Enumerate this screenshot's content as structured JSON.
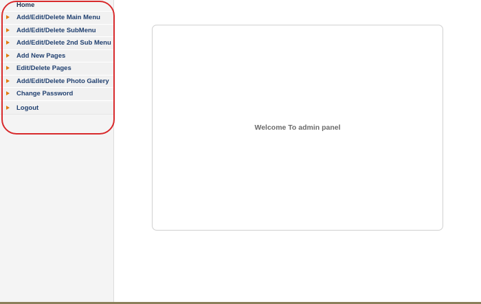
{
  "sidebar": {
    "items": [
      {
        "label": "Home"
      },
      {
        "label": "Add/Edit/Delete Main Menu"
      },
      {
        "label": "Add/Edit/Delete SubMenu"
      },
      {
        "label": "Add/Edit/Delete 2nd Sub Menu"
      },
      {
        "label": "Add New Pages"
      },
      {
        "label": "Edit/Delete Pages"
      },
      {
        "label": "Add/Edit/Delete Photo Gallery"
      },
      {
        "label": "Change Password"
      },
      {
        "label": "Logout"
      }
    ]
  },
  "main": {
    "welcome_text": "Welcome To admin panel"
  },
  "colors": {
    "link": "#1f3f6f",
    "bullet": "#e07a10",
    "highlight": "#d8282a"
  }
}
